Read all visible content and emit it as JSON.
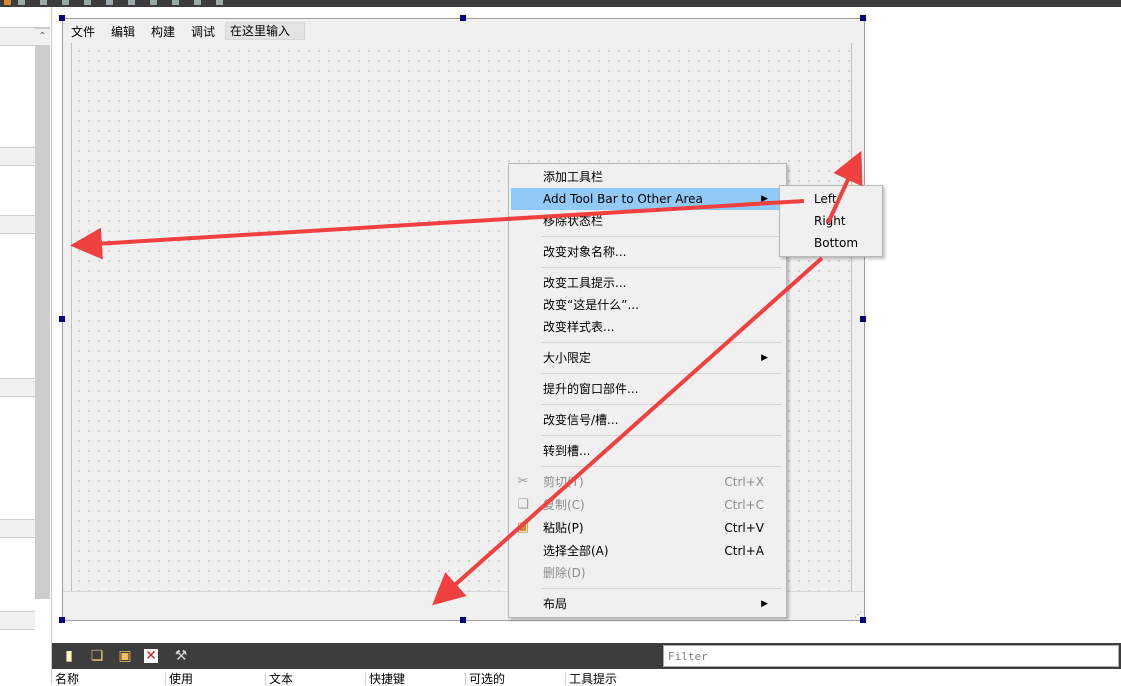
{
  "form": {
    "menubar": [
      {
        "label": "文件"
      },
      {
        "label": "编辑"
      },
      {
        "label": "构建"
      },
      {
        "label": "调试"
      }
    ],
    "menu_input_placeholder": "在这里输入"
  },
  "context_menu": {
    "items": {
      "add_toolbar": "添加工具栏",
      "add_toolbar_other": "Add Tool Bar to Other Area",
      "remove_statusbar": "移除状态栏",
      "rename_object": "改变对象名称...",
      "change_tooltip": "改变工具提示...",
      "change_whatsthis": "改变“这是什么”...",
      "change_stylesheet": "改变样式表...",
      "size_constraints": "大小限定",
      "promoted_widgets": "提升的窗口部件...",
      "change_signals": "改变信号/槽...",
      "goto_slot": "转到槽...",
      "cut": "剪切(T)",
      "cut_shortcut": "Ctrl+X",
      "copy": "复制(C)",
      "copy_shortcut": "Ctrl+C",
      "paste": "粘贴(P)",
      "paste_shortcut": "Ctrl+V",
      "select_all": "选择全部(A)",
      "select_all_shortcut": "Ctrl+A",
      "delete": "删除(D)",
      "layout": "布局"
    }
  },
  "submenu": {
    "left": "Left",
    "right": "Right",
    "bottom": "Bottom"
  },
  "action_editor": {
    "filter_placeholder": "Filter",
    "columns": [
      "名称",
      "使用",
      "文本",
      "快捷键",
      "可选的",
      "工具提示"
    ]
  },
  "colors": {
    "highlight": "#91c9f7",
    "arrow": "#f04040",
    "handle": "#000080"
  }
}
